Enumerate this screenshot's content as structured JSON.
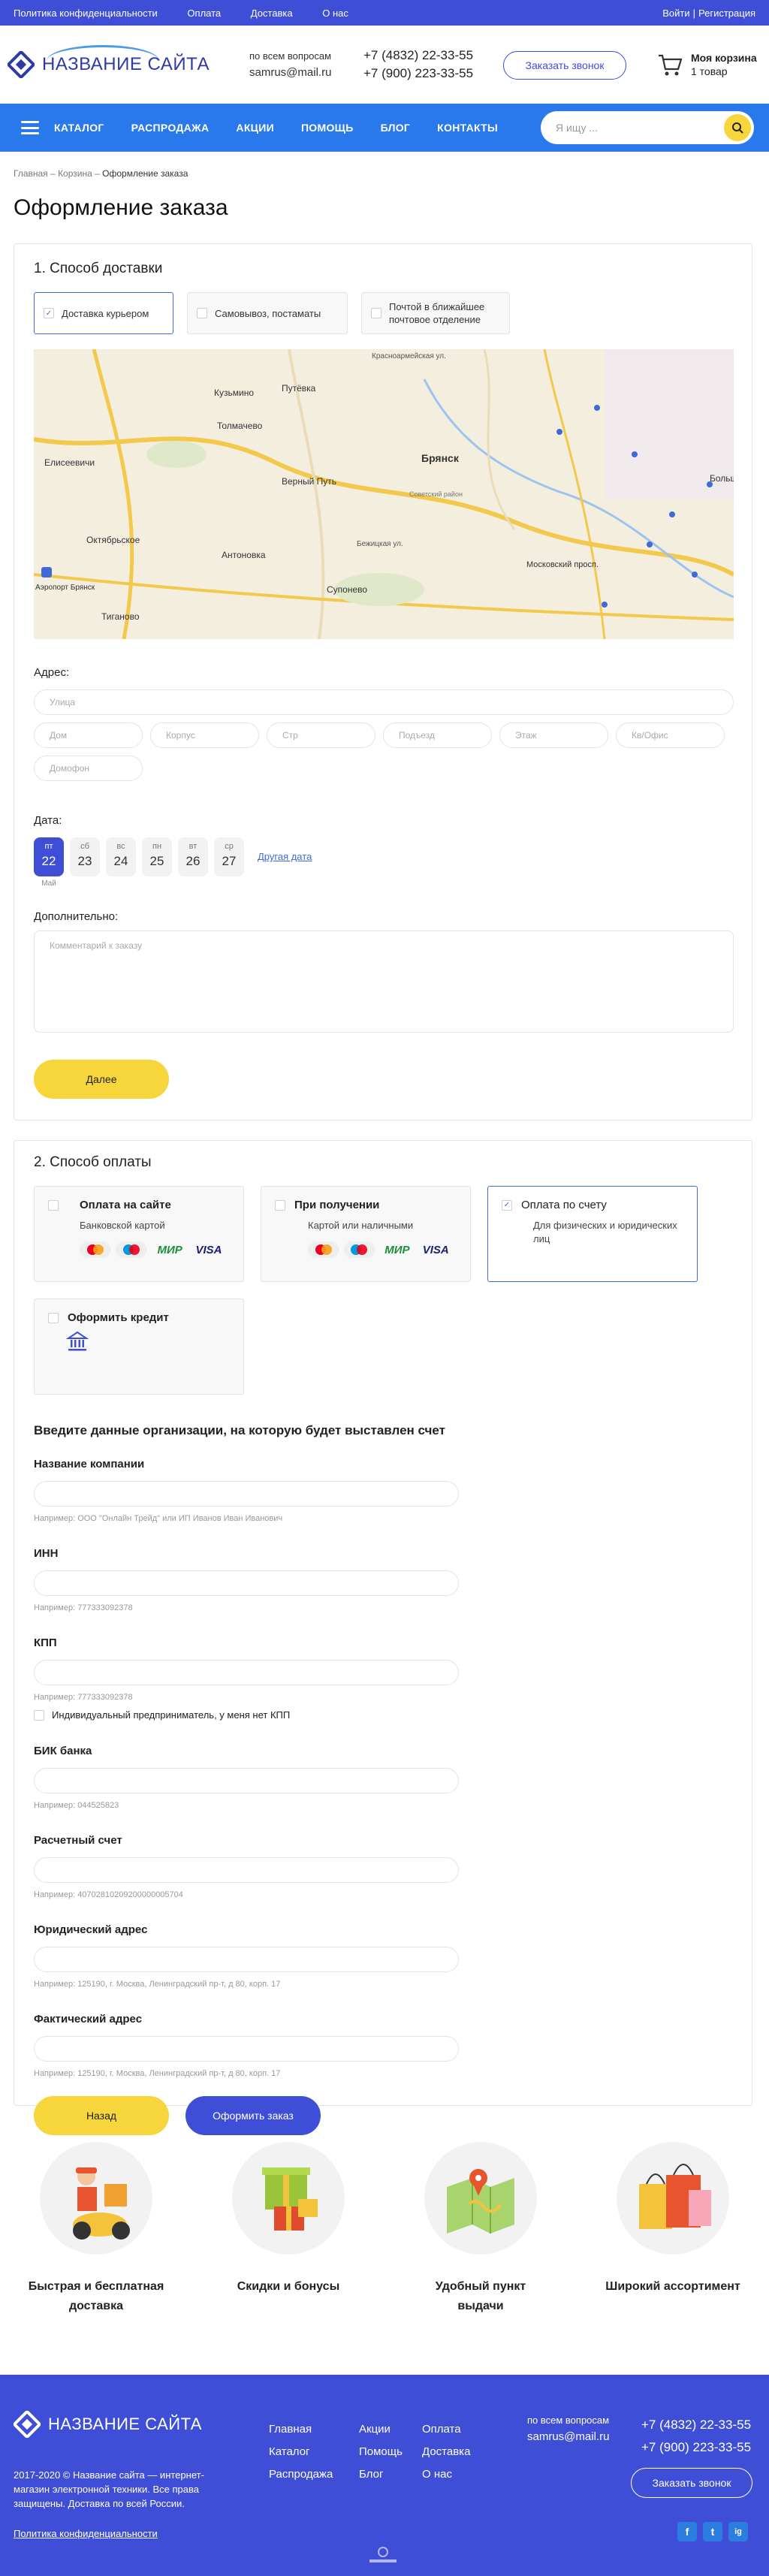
{
  "topbar": {
    "links": [
      "Политика конфиденциальности",
      "Оплата",
      "Доставка",
      "О нас"
    ],
    "login": "Войти",
    "sep": "|",
    "register": "Регистрация"
  },
  "header": {
    "logo_text": "НАЗВАНИЕ САЙТА",
    "contact_caption": "по всем вопросам",
    "email": "samrus@mail.ru",
    "phone1": "+7 (4832) 22-33-55",
    "phone2": "+7 (900) 223-33-55",
    "callback_label": "Заказать звонок",
    "cart_title": "Моя корзина",
    "cart_count": "1 товар"
  },
  "nav": {
    "items": [
      "КАТАЛОГ",
      "РАСПРОДАЖА",
      "АКЦИИ",
      "ПОМОЩЬ",
      "БЛОГ",
      "КОНТАКТЫ"
    ],
    "search_placeholder": "Я ищу ..."
  },
  "breadcrumbs": {
    "home": "Главная",
    "cart": "Корзина",
    "current": "Оформление заказа",
    "sep": "–"
  },
  "page_title": "Оформление заказа",
  "delivery": {
    "heading": "1. Способ доставки",
    "tabs": [
      {
        "label": "Доставка курьером",
        "active": true
      },
      {
        "label": "Самовывоз, постаматы",
        "active": false
      },
      {
        "label": "Почтой в ближайшее почтовое отделение",
        "active": false
      }
    ],
    "map_labels": [
      "Кузьмино",
      "Путёвка",
      "Толмачево",
      "Елисеевичи",
      "Верный Путь",
      "Брянск",
      "Октябрьское",
      "Антоновка",
      "Супонево",
      "Тиганово",
      "Московский просп.",
      "Больш",
      "Советский район",
      "Бежицкая ул.",
      "Красноармейская ул.",
      "Аэропорт Брянск"
    ],
    "address_label": "Адрес:",
    "street_placeholder": "Улица",
    "fields": [
      "Дом",
      "Корпус",
      "Стр",
      "Подъезд",
      "Этаж",
      "Кв/Офис",
      "Домофон"
    ],
    "date_label": "Дата:",
    "dates": [
      {
        "dow": "пт",
        "day": "22",
        "active": true
      },
      {
        "dow": "сб",
        "day": "23",
        "active": false
      },
      {
        "dow": "вс",
        "day": "24",
        "active": false
      },
      {
        "dow": "пн",
        "day": "25",
        "active": false
      },
      {
        "dow": "вт",
        "day": "26",
        "active": false
      },
      {
        "dow": "ср",
        "day": "27",
        "active": false
      }
    ],
    "month": "Май",
    "other_date": "Другая дата",
    "extra_label": "Дополнительно:",
    "comment_placeholder": "Комментарий к заказу",
    "next_label": "Далее"
  },
  "payment": {
    "heading": "2. Способ оплаты",
    "methods": [
      {
        "title": "Оплата на сайте",
        "sub": "Банковской картой",
        "cards": true,
        "active": false
      },
      {
        "title": "При получении",
        "sub": "Картой или наличными",
        "cards": true,
        "active": false
      },
      {
        "title": "Оплата по счету",
        "sub": "Для физических и юридических лиц",
        "cards": false,
        "active": true
      },
      {
        "title": "Оформить кредит",
        "sub": "",
        "cards": false,
        "active": false
      }
    ],
    "card_brands": [
      "mastercard",
      "Maestro",
      "МИР",
      "VISA"
    ],
    "org_heading": "Введите данные организации, на которую будет выставлен счет",
    "fields": [
      {
        "label": "Название компании",
        "hint": "Например: ООО \"Онлайн Трейд\" или ИП Иванов Иван Иванович"
      },
      {
        "label": "ИНН",
        "hint": "Например: 777333092378"
      },
      {
        "label": "КПП",
        "hint": "Например: 777333092378"
      },
      {
        "label": "БИК банка",
        "hint": "Например: 044525823"
      },
      {
        "label": "Расчетный счет",
        "hint": "Например: 40702810209200000005704"
      },
      {
        "label": "Юридический адрес",
        "hint": "Например: 125190, г. Москва, Ленинградский пр-т, д 80, корп. 17"
      },
      {
        "label": "Фактический адрес",
        "hint": "Например: 125190, г. Москва, Ленинградский пр-т, д 80, корп. 17"
      }
    ],
    "ip_checkbox": "Индивидуальный предприниматель, у меня нет КПП",
    "back_label": "Назад",
    "submit_label": "Оформить заказ"
  },
  "features": [
    {
      "line1": "Быстрая и бесплатная",
      "line2": "доставка",
      "icon": "courier-icon"
    },
    {
      "line1": "Скидки и бонусы",
      "line2": "",
      "icon": "gift-icon"
    },
    {
      "line1": "Удобный пункт",
      "line2": "выдачи",
      "icon": "map-pin-icon"
    },
    {
      "line1": "Широкий ассортимент",
      "line2": "",
      "icon": "shopping-bags-icon"
    }
  ],
  "footer": {
    "logo_text": "НАЗВАНИЕ САЙТА",
    "copyright": "2017-2020 © Название сайта — интернет-магазин электронной техники. Все права защищены. Доставка по всей России.",
    "policy": "Политика конфиденциальности",
    "col1": [
      "Главная",
      "Каталог",
      "Распродажа"
    ],
    "col2": [
      "Акции",
      "Помощь",
      "Блог"
    ],
    "col3": [
      "Оплата",
      "Доставка",
      "О нас"
    ],
    "contact_caption": "по всем вопросам",
    "email": "samrus@mail.ru",
    "phone1": "+7 (4832) 22-33-55",
    "phone2": "+7 (900) 223-33-55",
    "callback_label": "Заказать звонок",
    "social": [
      "f",
      "t",
      "ig"
    ]
  },
  "colors": {
    "primary": "#3f4ed6",
    "nav": "#2979ed",
    "accent": "#f7d63c",
    "border_active": "#3f6ad8"
  }
}
